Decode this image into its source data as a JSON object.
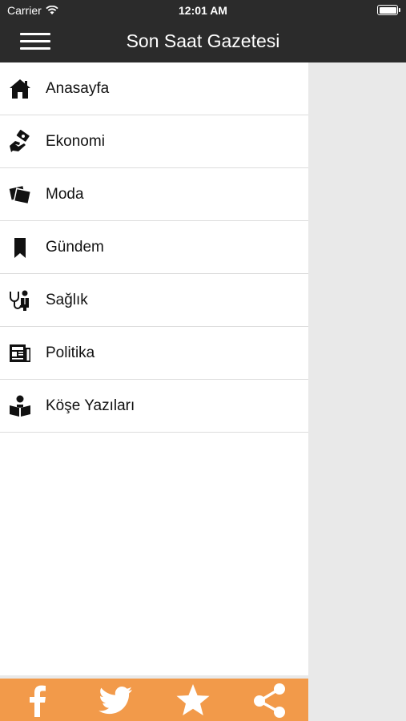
{
  "status_bar": {
    "carrier": "Carrier",
    "time": "12:01 AM"
  },
  "header": {
    "title": "Son Saat Gazetesi"
  },
  "menu": [
    {
      "label": "Anasayfa",
      "icon": "home-icon"
    },
    {
      "label": "Ekonomi",
      "icon": "money-hand-icon"
    },
    {
      "label": "Moda",
      "icon": "fashion-card-icon"
    },
    {
      "label": "Gündem",
      "icon": "bookmark-icon"
    },
    {
      "label": "Sağlık",
      "icon": "doctor-stethoscope-icon"
    },
    {
      "label": "Politika",
      "icon": "newspaper-icon"
    },
    {
      "label": "Köşe Yazıları",
      "icon": "reader-book-icon"
    }
  ],
  "footer": {
    "buttons": [
      "facebook-icon",
      "twitter-icon",
      "star-icon",
      "share-icon"
    ]
  },
  "colors": {
    "bar": "#2b2b2b",
    "footer": "#f29a4a",
    "drawer": "#ffffff",
    "backdrop": "#e9e9e9"
  }
}
